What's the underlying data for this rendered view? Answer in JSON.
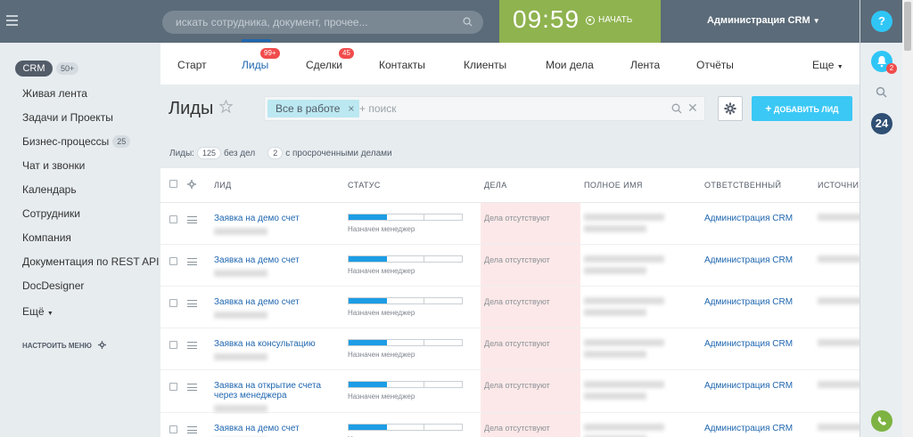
{
  "header": {
    "search_placeholder": "искать сотрудника, документ, прочее...",
    "clock": "09:59",
    "start_label": "НАЧАТЬ",
    "user_name": "Администрация CRM"
  },
  "right_panel": {
    "help_label": "?",
    "notifications_count": "2",
    "b24_label": "24"
  },
  "sidebar": {
    "crm_label": "CRM",
    "crm_count": "50+",
    "items": [
      {
        "label": "Живая лента"
      },
      {
        "label": "Задачи и Проекты"
      },
      {
        "label": "Бизнес-процессы",
        "badge": "25"
      },
      {
        "label": "Чат и звонки"
      },
      {
        "label": "Календарь"
      },
      {
        "label": "Сотрудники"
      },
      {
        "label": "Компания"
      },
      {
        "label": "Документация по REST API"
      },
      {
        "label": "DocDesigner"
      },
      {
        "label": "Ещё"
      }
    ],
    "settings_label": "НАСТРОИТЬ МЕНЮ"
  },
  "tabs": [
    {
      "label": "Старт"
    },
    {
      "label": "Лиды",
      "badge": "99+",
      "active": true
    },
    {
      "label": "Сделки",
      "badge": "45"
    },
    {
      "label": "Контакты"
    },
    {
      "label": "Клиенты"
    },
    {
      "label": "Мои дела"
    },
    {
      "label": "Лента"
    },
    {
      "label": "Отчёты"
    },
    {
      "label": "Еще"
    }
  ],
  "page": {
    "title": "Лиды",
    "filter_chip": "Все в работе",
    "filter_placeholder": "+ поиск",
    "add_button": "ДОБАВИТЬ ЛИД",
    "counters": {
      "leads_label": "Лиды:",
      "leads_count": "125",
      "no_deals_label": "без дел",
      "overdue_count": "2",
      "overdue_label": "с просроченными делами"
    }
  },
  "grid": {
    "columns": [
      "ЛИД",
      "СТАТУС",
      "ДЕЛА",
      "ПОЛНОЕ ИМЯ",
      "ОТВЕТСТВЕННЫЙ",
      "ИСТОЧНИК"
    ],
    "rows": [
      {
        "lead": "Заявка на демо счет",
        "status": "Назначен менеджер",
        "deals": "Дела отсутствуют",
        "responsible": "Администрация CRM"
      },
      {
        "lead": "Заявка на демо счет",
        "status": "Назначен менеджер",
        "deals": "Дела отсутствуют",
        "responsible": "Администрация CRM"
      },
      {
        "lead": "Заявка на демо счет",
        "status": "Назначен менеджер",
        "deals": "Дела отсутствуют",
        "responsible": "Администрация CRM"
      },
      {
        "lead": "Заявка на консультацию",
        "status": "Назначен менеджер",
        "deals": "Дела отсутствуют",
        "responsible": "Администрация CRM"
      },
      {
        "lead": "Заявка на открытие счета через менеджера",
        "status": "Назначен менеджер",
        "deals": "Дела отсутствуют",
        "responsible": "Администрация CRM"
      },
      {
        "lead": "Заявка на демо счет",
        "status": "Назначен менеджер",
        "deals": "Дела отсутствуют",
        "responsible": "Администрация CRM"
      }
    ],
    "progress_filled_segments": 1,
    "progress_total_segments": 3
  },
  "colors": {
    "topbar": "#5b6b79",
    "timer_bg": "#8fb34f",
    "accent_blue": "#2fc6f6",
    "link": "#2067b0",
    "deals_bg": "#fce8e8",
    "badge_red": "#f14c4c"
  }
}
